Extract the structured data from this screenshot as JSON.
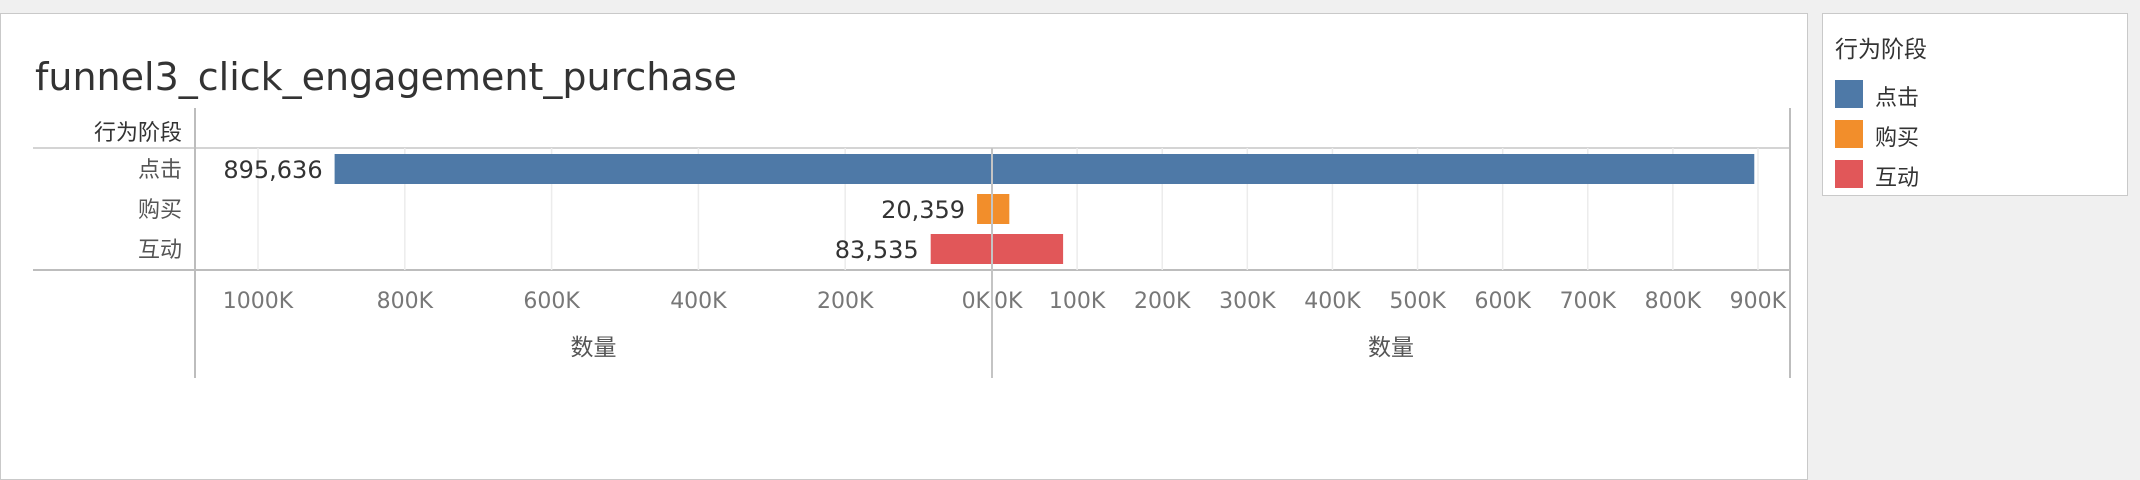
{
  "title": "funnel3_click_engagement_purchase",
  "legend": {
    "title": "行为阶段",
    "items": [
      {
        "label": "点击",
        "color": "#4e79a7"
      },
      {
        "label": "购买",
        "color": "#f28e2b"
      },
      {
        "label": "互动",
        "color": "#e15759"
      }
    ]
  },
  "chart_data": {
    "type": "bar",
    "orientation": "horizontal",
    "layout": "butterfly",
    "row_header": "行为阶段",
    "categories": [
      "点击",
      "购买",
      "互动"
    ],
    "values": [
      895636,
      20359,
      83535
    ],
    "value_labels": [
      "895,636",
      "20,359",
      "83,535"
    ],
    "colors": [
      "#4e79a7",
      "#f28e2b",
      "#e15759"
    ],
    "left_axis": {
      "label": "数量",
      "reversed": true,
      "range": [
        0,
        1000000
      ],
      "ticks": [
        1000000,
        800000,
        600000,
        400000,
        200000,
        0
      ],
      "tick_labels": [
        "1000K",
        "800K",
        "600K",
        "400K",
        "200K",
        "0K"
      ]
    },
    "right_axis": {
      "label": "数量",
      "range": [
        0,
        900000
      ],
      "ticks": [
        0,
        100000,
        200000,
        300000,
        400000,
        500000,
        600000,
        700000,
        800000,
        900000
      ],
      "tick_labels": [
        "0K",
        "100K",
        "200K",
        "300K",
        "400K",
        "500K",
        "600K",
        "700K",
        "800K",
        "900K"
      ]
    },
    "grid": true
  }
}
